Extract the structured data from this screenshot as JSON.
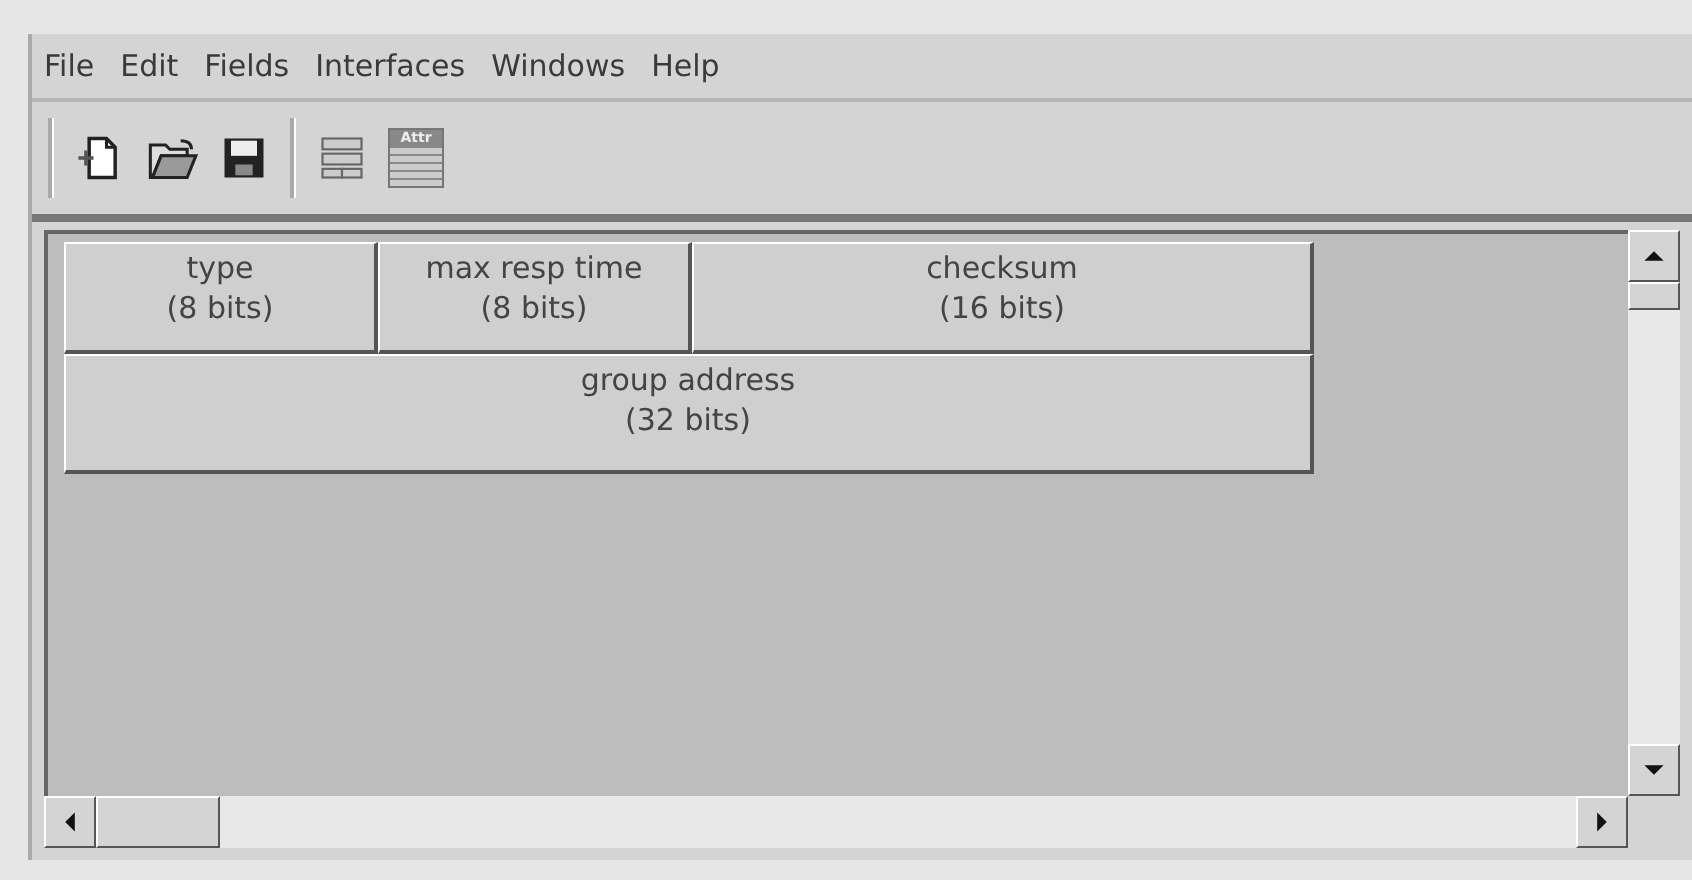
{
  "menu": [
    "File",
    "Edit",
    "Fields",
    "Interfaces",
    "Windows",
    "Help"
  ],
  "toolbar": [
    {
      "kind": "new"
    },
    {
      "kind": "open"
    },
    {
      "kind": "save"
    },
    {
      "kind": "separator"
    },
    {
      "kind": "fields"
    },
    {
      "kind": "attr",
      "label": "Attr"
    }
  ],
  "packet_rows": [
    {
      "fields": [
        {
          "name": "type",
          "size": "(8 bits)"
        },
        {
          "name": "max resp time",
          "size": "(8 bits)"
        },
        {
          "name": "checksum",
          "size": "(16 bits)"
        }
      ]
    },
    {
      "fields": [
        {
          "name": "group address",
          "size": "(32 bits)"
        }
      ]
    }
  ]
}
